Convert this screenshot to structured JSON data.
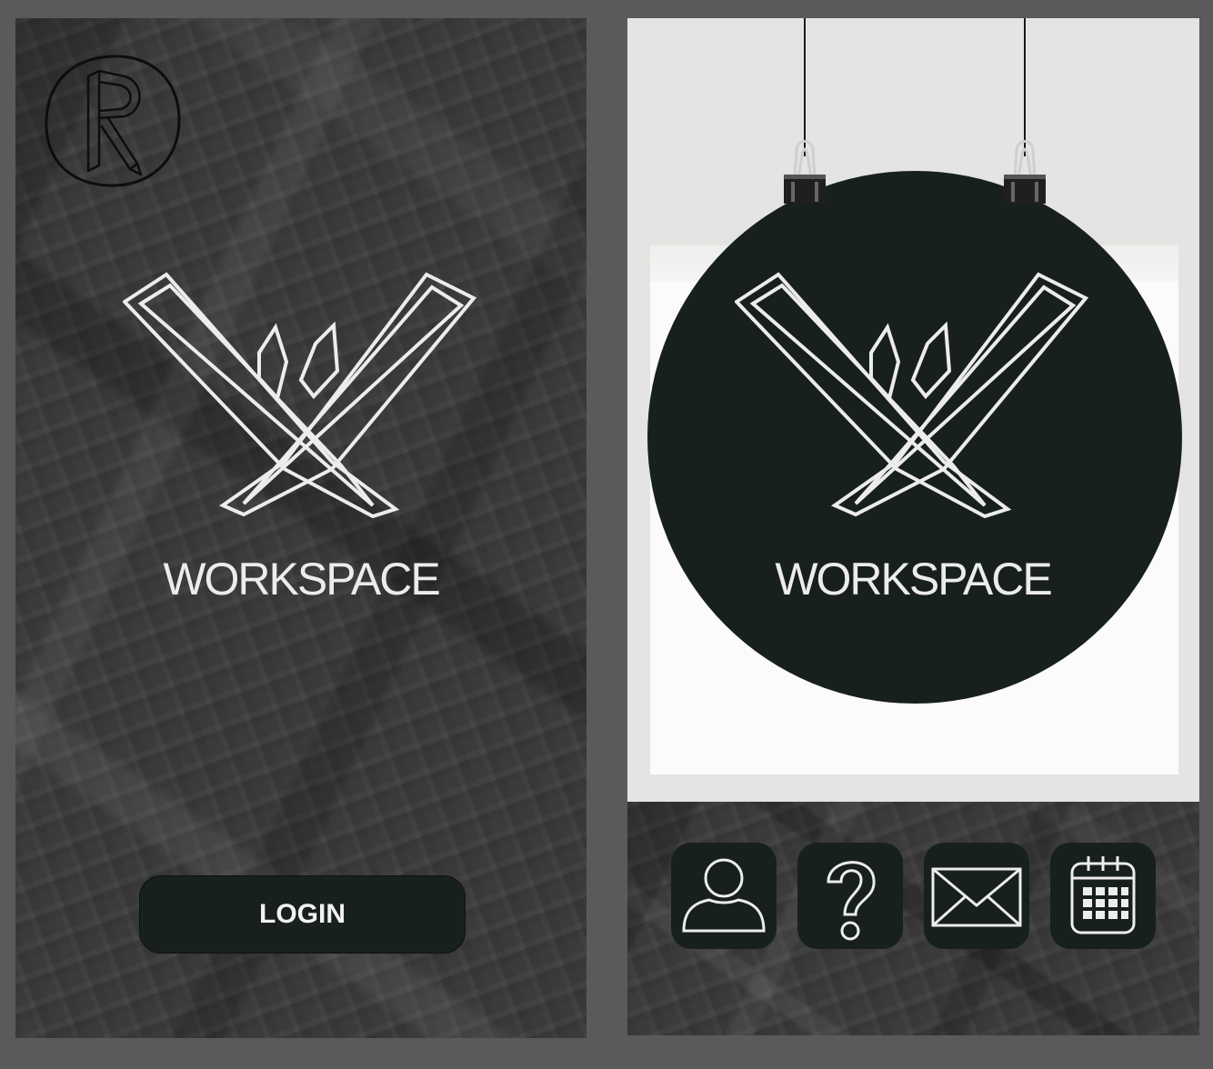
{
  "login_screen": {
    "brand": "WORKSPACE",
    "login_label": "LOGIN",
    "avatar_icon": "r-monogram-icon",
    "logo_icon": "workspace-w-logo-icon"
  },
  "home_screen": {
    "brand": "WORKSPACE",
    "logo_icon": "workspace-w-logo-icon",
    "nav": [
      {
        "icon": "profile-icon"
      },
      {
        "icon": "help-icon"
      },
      {
        "icon": "mail-icon"
      },
      {
        "icon": "calendar-icon"
      }
    ]
  },
  "colors": {
    "frame": "#5a5a5a",
    "tile": "#18201e",
    "logo_stroke": "#ececec",
    "wall": "#e4e4e2"
  }
}
